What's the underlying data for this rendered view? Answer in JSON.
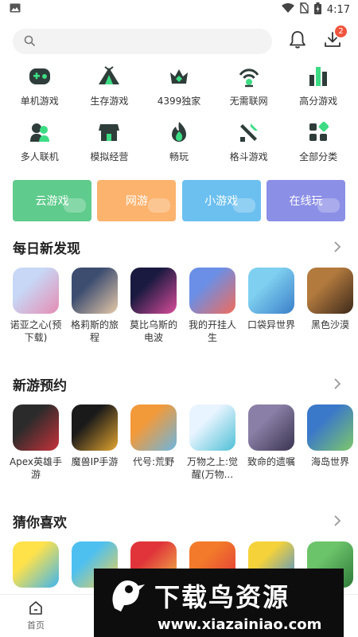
{
  "status": {
    "time": "4:17"
  },
  "search": {
    "placeholder": ""
  },
  "header": {
    "download_badge": "2"
  },
  "categories": [
    {
      "label": "单机游戏",
      "icon": "gamepad-icon"
    },
    {
      "label": "生存游戏",
      "icon": "tent-icon"
    },
    {
      "label": "4399独家",
      "icon": "crown-icon"
    },
    {
      "label": "无需联网",
      "icon": "no-wifi-icon"
    },
    {
      "label": "高分游戏",
      "icon": "bars-icon"
    },
    {
      "label": "多人联机",
      "icon": "multiplayer-icon"
    },
    {
      "label": "模拟经营",
      "icon": "shop-icon"
    },
    {
      "label": "畅玩",
      "icon": "flame-icon"
    },
    {
      "label": "格斗游戏",
      "icon": "sword-icon"
    },
    {
      "label": "全部分类",
      "icon": "grid-icon"
    }
  ],
  "quick_links": [
    {
      "label": "云游戏",
      "color": "#5fcb8c"
    },
    {
      "label": "网游",
      "color": "#fbb36e"
    },
    {
      "label": "小游戏",
      "color": "#6cc0ef"
    },
    {
      "label": "在线玩",
      "color": "#8c8fe6"
    }
  ],
  "sections": [
    {
      "title": "每日新发现",
      "games": [
        {
          "name": "诺亚之心(预下载)",
          "colors": [
            "#c7d7f5",
            "#e58cb3"
          ]
        },
        {
          "name": "格莉斯的旅程",
          "colors": [
            "#3c4d70",
            "#e6c9a8"
          ]
        },
        {
          "name": "莫比乌斯的电波",
          "colors": [
            "#1a1a40",
            "#d94c9a"
          ]
        },
        {
          "name": "我的开挂人生",
          "colors": [
            "#6b8fe6",
            "#f26b5a"
          ]
        },
        {
          "name": "口袋异世界",
          "colors": [
            "#7fd0f0",
            "#3a7fc9"
          ]
        },
        {
          "name": "黑色沙漠",
          "colors": [
            "#b37a3e",
            "#3d2a1a"
          ]
        }
      ]
    },
    {
      "title": "新游预约",
      "games": [
        {
          "name": "Apex英雄手游",
          "colors": [
            "#2b2b2b",
            "#c8323a"
          ]
        },
        {
          "name": "魔兽IP手游",
          "colors": [
            "#1a1a1a",
            "#e3a52e"
          ]
        },
        {
          "name": "代号:荒野",
          "colors": [
            "#f29a3a",
            "#6bb5e0"
          ]
        },
        {
          "name": "万物之上:觉醒(万物...",
          "colors": [
            "#e8f4ff",
            "#4ec0d6"
          ]
        },
        {
          "name": "致命的遗嘱",
          "colors": [
            "#8a7fa6",
            "#3a3450"
          ]
        },
        {
          "name": "海岛世界",
          "colors": [
            "#3a78c9",
            "#7ec86a"
          ]
        }
      ]
    },
    {
      "title": "猜你喜欢",
      "games": [
        {
          "name": "",
          "colors": [
            "#ffe24a",
            "#3fb5ef"
          ]
        },
        {
          "name": "",
          "colors": [
            "#4ec0f0",
            "#f5d24a"
          ]
        },
        {
          "name": "",
          "colors": [
            "#e0343a",
            "#f2c14a"
          ]
        },
        {
          "name": "",
          "colors": [
            "#f27a2a",
            "#e0343a"
          ]
        },
        {
          "name": "",
          "colors": [
            "#f5d23a",
            "#3a8ae0"
          ]
        },
        {
          "name": "",
          "colors": [
            "#6cc46a",
            "#2f7a3a"
          ]
        }
      ]
    }
  ],
  "tabs": [
    {
      "label": "首页"
    },
    {
      "label": ""
    },
    {
      "label": ""
    },
    {
      "label": ""
    },
    {
      "label": ""
    }
  ],
  "watermark": {
    "title": "下载鸟资源",
    "url": "www.xiazainiao.com"
  }
}
